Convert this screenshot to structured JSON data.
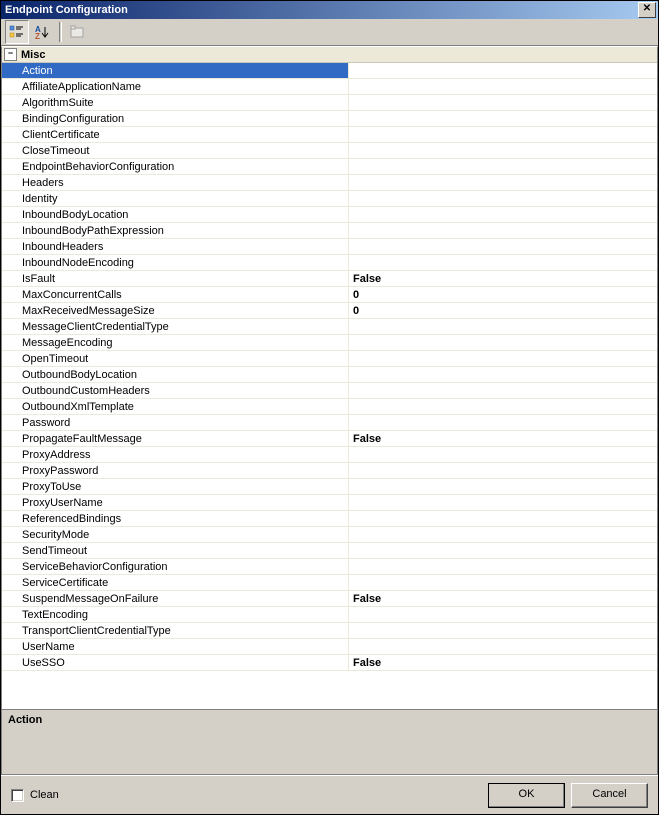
{
  "window": {
    "title": "Endpoint Configuration",
    "close_icon": "✕"
  },
  "toolbar": {
    "categorized_tooltip": "Categorized",
    "alphabetical_tooltip": "Alphabetical",
    "property_pages_tooltip": "Property Pages"
  },
  "grid": {
    "category_label": "Misc",
    "expander_glyph": "−",
    "selected_property": "Action",
    "properties": [
      {
        "name": "Action",
        "value": ""
      },
      {
        "name": "AffiliateApplicationName",
        "value": ""
      },
      {
        "name": "AlgorithmSuite",
        "value": ""
      },
      {
        "name": "BindingConfiguration",
        "value": ""
      },
      {
        "name": "ClientCertificate",
        "value": ""
      },
      {
        "name": "CloseTimeout",
        "value": ""
      },
      {
        "name": "EndpointBehaviorConfiguration",
        "value": ""
      },
      {
        "name": "Headers",
        "value": ""
      },
      {
        "name": "Identity",
        "value": ""
      },
      {
        "name": "InboundBodyLocation",
        "value": ""
      },
      {
        "name": "InboundBodyPathExpression",
        "value": ""
      },
      {
        "name": "InboundHeaders",
        "value": ""
      },
      {
        "name": "InboundNodeEncoding",
        "value": ""
      },
      {
        "name": "IsFault",
        "value": "False"
      },
      {
        "name": "MaxConcurrentCalls",
        "value": "0"
      },
      {
        "name": "MaxReceivedMessageSize",
        "value": "0"
      },
      {
        "name": "MessageClientCredentialType",
        "value": ""
      },
      {
        "name": "MessageEncoding",
        "value": ""
      },
      {
        "name": "OpenTimeout",
        "value": ""
      },
      {
        "name": "OutboundBodyLocation",
        "value": ""
      },
      {
        "name": "OutboundCustomHeaders",
        "value": ""
      },
      {
        "name": "OutboundXmlTemplate",
        "value": ""
      },
      {
        "name": "Password",
        "value": ""
      },
      {
        "name": "PropagateFaultMessage",
        "value": "False"
      },
      {
        "name": "ProxyAddress",
        "value": ""
      },
      {
        "name": "ProxyPassword",
        "value": ""
      },
      {
        "name": "ProxyToUse",
        "value": ""
      },
      {
        "name": "ProxyUserName",
        "value": ""
      },
      {
        "name": "ReferencedBindings",
        "value": ""
      },
      {
        "name": "SecurityMode",
        "value": ""
      },
      {
        "name": "SendTimeout",
        "value": ""
      },
      {
        "name": "ServiceBehaviorConfiguration",
        "value": ""
      },
      {
        "name": "ServiceCertificate",
        "value": ""
      },
      {
        "name": "SuspendMessageOnFailure",
        "value": "False"
      },
      {
        "name": "TextEncoding",
        "value": ""
      },
      {
        "name": "TransportClientCredentialType",
        "value": ""
      },
      {
        "name": "UserName",
        "value": ""
      },
      {
        "name": "UseSSO",
        "value": "False"
      }
    ]
  },
  "description": {
    "title": "Action",
    "text": ""
  },
  "footer": {
    "clean_label": "Clean",
    "ok_label": "OK",
    "cancel_label": "Cancel"
  }
}
